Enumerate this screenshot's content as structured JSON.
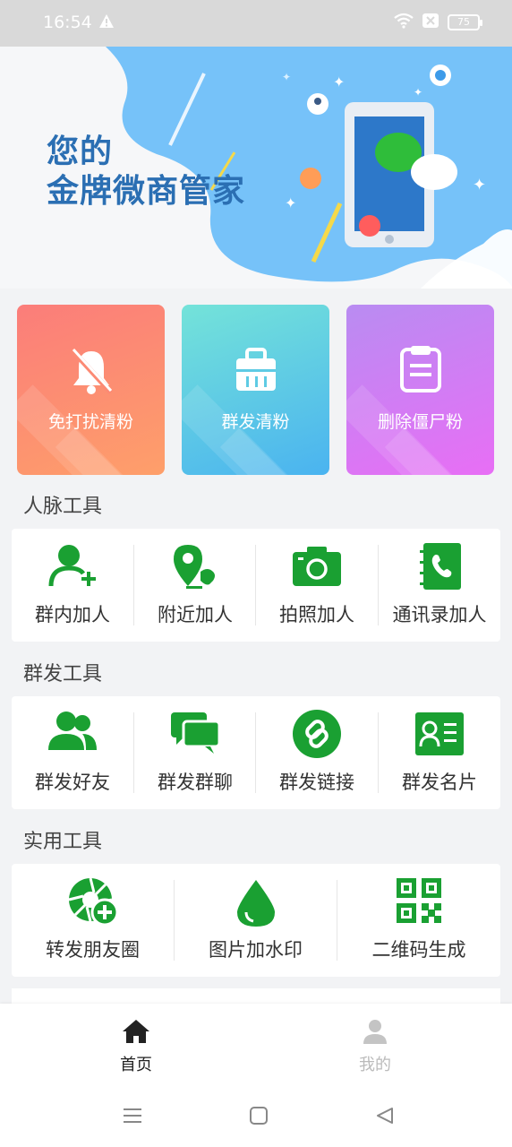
{
  "status_bar": {
    "time": "16:54",
    "battery": "75",
    "icons": [
      "warning-icon",
      "wifi-icon",
      "sim-icon",
      "battery-icon"
    ]
  },
  "banner": {
    "title_line1": "您的",
    "title_line2": "金牌微商管家",
    "colors": {
      "background": "#76c2f9",
      "title": "#2b6fb3",
      "phone": "#e9eef4",
      "screen": "#2d78c9"
    }
  },
  "feature_cards": [
    {
      "label": "免打扰清粉",
      "icon": "bell-off-icon",
      "color": "#fc8a74"
    },
    {
      "label": "群发清粉",
      "icon": "bag-icon",
      "color": "#5fcbe4"
    },
    {
      "label": "删除僵尸粉",
      "icon": "clipboard-icon",
      "color": "#d07cf4"
    }
  ],
  "sections": {
    "contacts": {
      "title": "人脉工具",
      "items": [
        {
          "label": "群内加人",
          "icon": "add-user-icon"
        },
        {
          "label": "附近加人",
          "icon": "location-user-icon"
        },
        {
          "label": "拍照加人",
          "icon": "camera-icon"
        },
        {
          "label": "通讯录加人",
          "icon": "contacts-book-icon"
        }
      ]
    },
    "broadcast": {
      "title": "群发工具",
      "items": [
        {
          "label": "群发好友",
          "icon": "friends-icon"
        },
        {
          "label": "群发群聊",
          "icon": "chat-bubbles-icon"
        },
        {
          "label": "群发链接",
          "icon": "link-icon"
        },
        {
          "label": "群发名片",
          "icon": "business-card-icon"
        }
      ]
    },
    "utility": {
      "title": "实用工具",
      "items": [
        {
          "label": "转发朋友圈",
          "icon": "moments-add-icon"
        },
        {
          "label": "图片加水印",
          "icon": "water-drop-icon"
        },
        {
          "label": "二维码生成",
          "icon": "qrcode-icon"
        }
      ]
    }
  },
  "tab_bar": {
    "home": "首页",
    "mine": "我的"
  },
  "accent_color": "#1aa032"
}
